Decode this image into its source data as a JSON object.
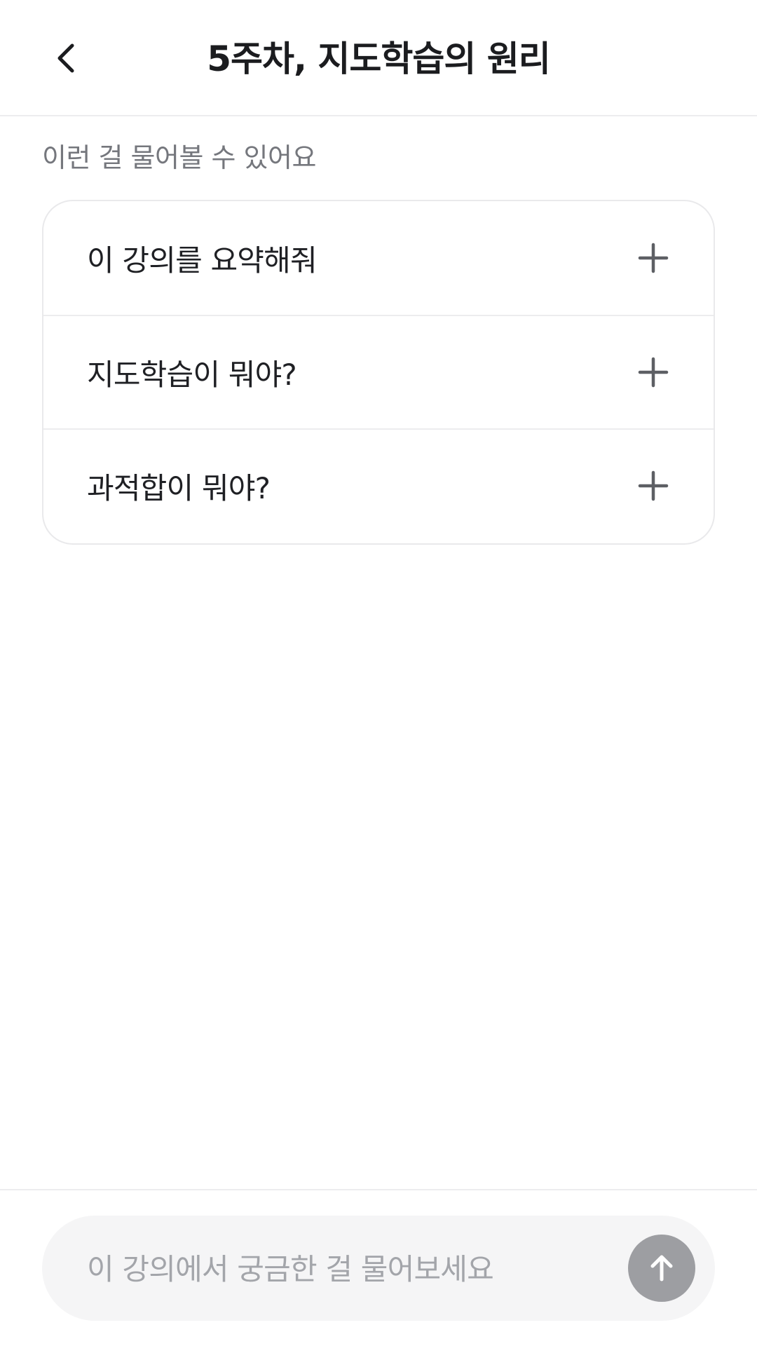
{
  "header": {
    "title": "5주차, 지도학습의 원리",
    "back_icon": "chevron-left-icon"
  },
  "suggestions": {
    "hint": "이런 걸 물어볼 수 있어요",
    "items": [
      {
        "label": "이 강의를 요약해줘",
        "icon": "plus-icon"
      },
      {
        "label": "지도학습이 뭐야?",
        "icon": "plus-icon"
      },
      {
        "label": "과적합이 뭐야?",
        "icon": "plus-icon"
      }
    ]
  },
  "composer": {
    "value": "",
    "placeholder": "이 강의에서 궁금한 걸 물어보세요",
    "send_icon": "arrow-up-icon"
  },
  "colors": {
    "title_text": "#1b1c1f",
    "hint_text": "#75777d",
    "divider": "#ececee",
    "composer_bg": "#f5f5f6",
    "send_button_disabled": "#9d9ea2",
    "icon_gray": "#5d5f64"
  }
}
